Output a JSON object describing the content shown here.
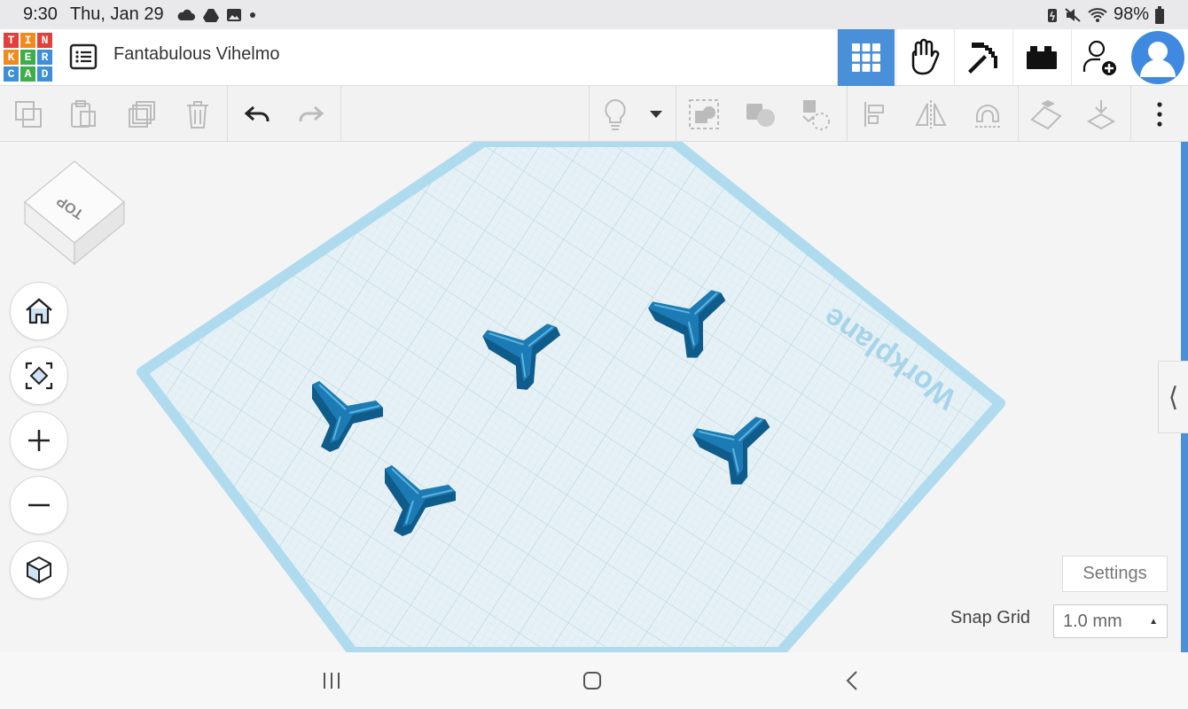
{
  "status_bar": {
    "time": "9:30",
    "date": "Thu, Jan 29",
    "battery": "98%",
    "icons_left": [
      "cloud-icon",
      "drive-icon",
      "gallery-icon",
      "dot-icon"
    ],
    "icons_right": [
      "battery-saver-icon",
      "mute-icon",
      "wifi-icon",
      "battery-icon"
    ]
  },
  "header": {
    "logo_letters": [
      "T",
      "I",
      "N",
      "K",
      "E",
      "R",
      "C",
      "A",
      "D"
    ],
    "project_name": "Fantabulous Vihelmo",
    "buttons": [
      "3d-view-grid-icon",
      "codeblocks-hand-icon",
      "minecraft-pickaxe-icon",
      "lego-brick-icon",
      "add-user-icon"
    ]
  },
  "toolbar": {
    "actions": [
      "copy",
      "paste",
      "duplicate",
      "delete",
      "undo",
      "redo",
      "toggle-visibility",
      "show-hidden-dropdown",
      "group",
      "ungroup",
      "cruise",
      "align",
      "mirror",
      "magnet",
      "workplane",
      "drop",
      "more"
    ]
  },
  "canvas": {
    "workplane_label": "Workplane",
    "viewcube_label": "TOP",
    "settings_label": "Settings",
    "snap_grid_label": "Snap Grid",
    "snap_grid_value": "1.0 mm",
    "collapse_label": "⟨"
  },
  "colors": {
    "accent": "#4a90d9",
    "shape_face": "#1c7bb4",
    "shape_top": "#2b9ad2",
    "shape_dark": "#0f5b8a",
    "workplane_fill": "#e6f1f6",
    "workplane_border": "#9fd3ea"
  }
}
